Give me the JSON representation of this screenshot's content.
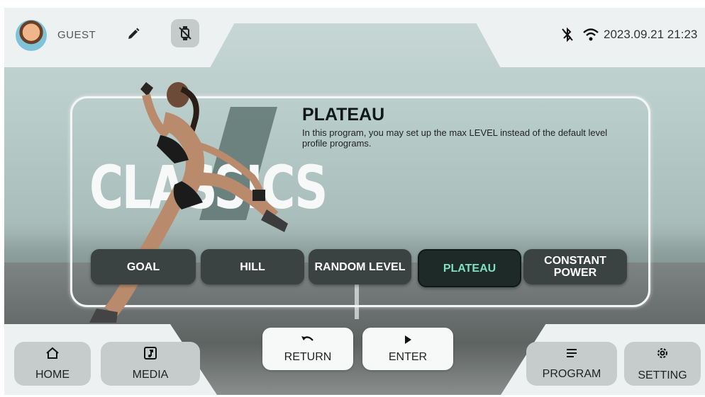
{
  "header": {
    "user_name": "GUEST",
    "datetime": "2023.09.21 21:23",
    "icons": [
      "avatar",
      "edit-icon",
      "watch-disconnected-icon",
      "bluetooth-icon",
      "wifi-icon"
    ]
  },
  "hero": {
    "category_word": "CLASSICS"
  },
  "program_info": {
    "title": "PLATEAU",
    "description": "In this program, you may set up the max LEVEL instead of the default level profile programs."
  },
  "programs": [
    {
      "label": "GOAL",
      "active": false
    },
    {
      "label": "HILL",
      "active": false
    },
    {
      "label": "RANDOM LEVEL",
      "active": false
    },
    {
      "label": "PLATEAU",
      "active": true
    },
    {
      "label": "CONSTANT POWER",
      "active": false
    }
  ],
  "bottom_nav": {
    "home": "HOME",
    "media": "MEDIA",
    "return": "RETURN",
    "enter": "ENTER",
    "program": "PROGRAM",
    "setting": "SETTING"
  },
  "colors": {
    "active_program_text": "#7fe0c0",
    "button_dark": "#3b4342",
    "bar_light": "#eef1f1"
  }
}
